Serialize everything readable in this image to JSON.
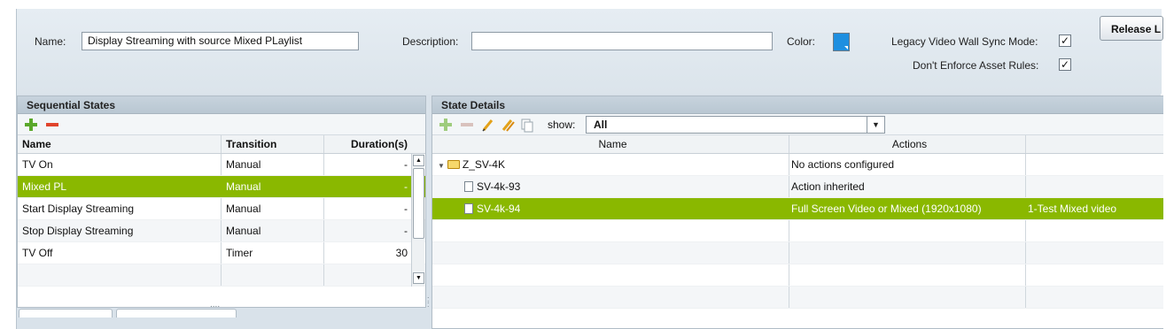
{
  "form": {
    "name_label": "Name:",
    "name_value": "Display Streaming with source Mixed PLaylist",
    "description_label": "Description:",
    "description_value": "",
    "color_label": "Color:",
    "color_value": "#1e8fe0",
    "legacy_label": "Legacy Video Wall Sync Mode:",
    "legacy_checked": "✓",
    "enforce_label": "Don't Enforce Asset Rules:",
    "enforce_checked": "✓",
    "release_button": "Release L"
  },
  "sequential": {
    "title": "Sequential States",
    "columns": [
      "Name",
      "Transition",
      "Duration(s)"
    ],
    "rows": [
      {
        "name": "TV On",
        "transition": "Manual",
        "duration": "-"
      },
      {
        "name": "Mixed PL",
        "transition": "Manual",
        "duration": "-",
        "selected": true
      },
      {
        "name": "Start Display Streaming",
        "transition": "Manual",
        "duration": "-"
      },
      {
        "name": "Stop Display Streaming",
        "transition": "Manual",
        "duration": "-"
      },
      {
        "name": "TV Off",
        "transition": "Timer",
        "duration": "30"
      }
    ],
    "grip": "...."
  },
  "details": {
    "title": "State Details",
    "show_label": "show:",
    "show_value": "All",
    "columns": [
      "Name",
      "Actions"
    ],
    "rows": [
      {
        "name": "Z_SV-4K",
        "actions": "No actions configured",
        "extra": "",
        "type": "folder"
      },
      {
        "name": "SV-4k-93",
        "actions": "Action inherited",
        "extra": "",
        "type": "file"
      },
      {
        "name": "SV-4k-94",
        "actions": "Full Screen Video or Mixed (1920x1080)",
        "extra": "1-Test Mixed video",
        "type": "file",
        "selected": true
      }
    ]
  },
  "colors": {
    "selection": "#8ab800",
    "header": "#b9c7d2",
    "background": "#d9e2ea"
  }
}
